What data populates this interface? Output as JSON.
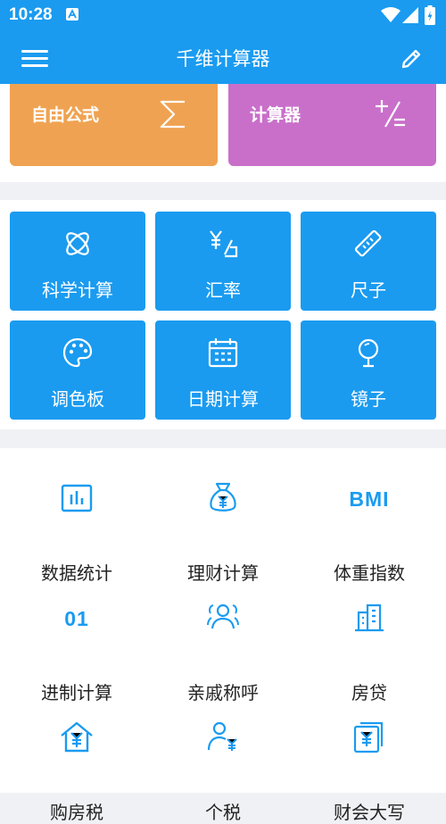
{
  "status_bar": {
    "time": "10:28"
  },
  "app_bar": {
    "title": "千维计算器"
  },
  "top_cards": [
    {
      "label": "自由公式",
      "icon": "sigma-icon",
      "color": "#efa352"
    },
    {
      "label": "计算器",
      "icon": "plus-minus-icon",
      "color": "#c96fca"
    }
  ],
  "grid": [
    {
      "label": "科学计算",
      "icon": "atom-icon"
    },
    {
      "label": "汇率",
      "icon": "exchange-rate-icon"
    },
    {
      "label": "尺子",
      "icon": "ruler-icon"
    },
    {
      "label": "调色板",
      "icon": "palette-icon"
    },
    {
      "label": "日期计算",
      "icon": "calendar-icon"
    },
    {
      "label": "镜子",
      "icon": "mirror-icon"
    }
  ],
  "list": [
    {
      "label": "数据统计",
      "icon": "chart-icon"
    },
    {
      "label": "理财计算",
      "icon": "money-bag-icon"
    },
    {
      "label": "体重指数",
      "icon": "bmi-icon",
      "icon_text": "BMI"
    },
    {
      "label": "进制计算",
      "icon": "binary-icon",
      "icon_text": "01"
    },
    {
      "label": "亲戚称呼",
      "icon": "relatives-icon"
    },
    {
      "label": "房贷",
      "icon": "building-icon"
    },
    {
      "label": "购房税",
      "icon": "house-yuan-icon"
    },
    {
      "label": "个税",
      "icon": "person-yuan-icon"
    },
    {
      "label": "财会大写",
      "icon": "yuan-documents-icon"
    }
  ],
  "colors": {
    "primary": "#1a9bf0",
    "formula": "#efa352",
    "calculator": "#c96fca",
    "background": "#f0f1f5"
  }
}
